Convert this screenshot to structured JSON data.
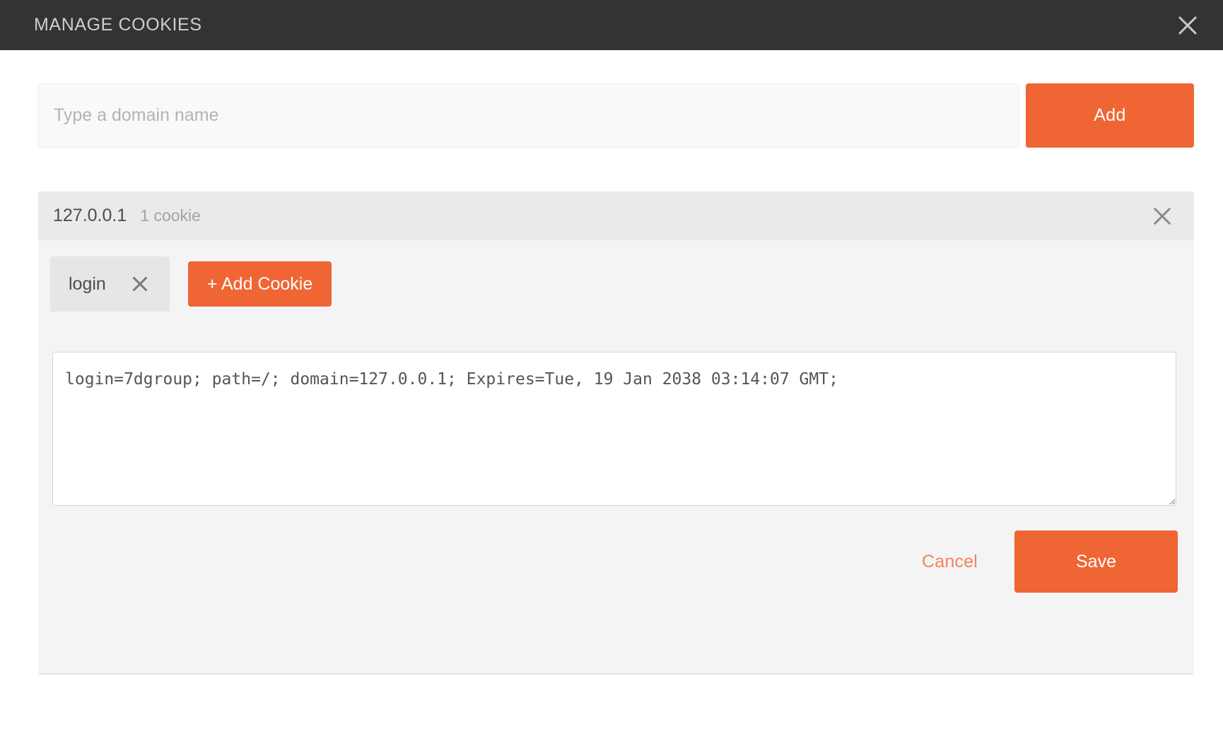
{
  "titlebar": {
    "title": "MANAGE COOKIES",
    "close_icon": "close-icon"
  },
  "add_domain": {
    "input_value": "",
    "input_placeholder": "Type a domain name",
    "add_label": "Add"
  },
  "panel": {
    "domain": "127.0.0.1",
    "cookie_count_label": "1 cookie",
    "close_icon": "close-icon",
    "cookie_tabs": [
      {
        "label": "login",
        "close_icon": "close-icon"
      }
    ],
    "add_cookie_label": "+ Add Cookie",
    "cookie_value": "login=7dgroup; path=/; domain=127.0.0.1; Expires=Tue, 19 Jan 2038 03:14:07 GMT;",
    "cookie_placeholder": "",
    "cancel_label": "Cancel",
    "save_label": "Save"
  },
  "colors": {
    "accent": "#ef6534",
    "accent_text": "#f4825c",
    "titlebar_bg": "#333333",
    "panel_bg": "#f4f4f4",
    "panel_header_bg": "#eaeaea"
  }
}
